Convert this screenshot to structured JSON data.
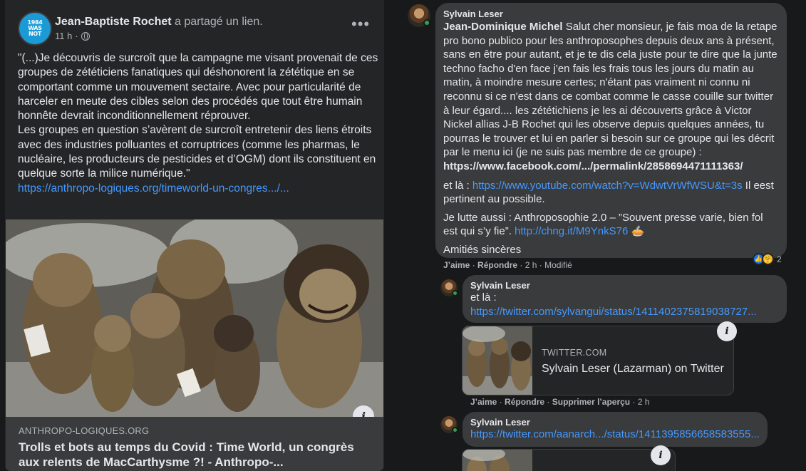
{
  "post": {
    "author": "Jean-Baptiste Rochet",
    "action": "a partagé un lien.",
    "time": "11 h",
    "separator": "·",
    "avatar_text": [
      "1984",
      "WAS",
      "NOT"
    ],
    "more_icon": "more-horizontal-icon",
    "privacy_icon": "globe-icon",
    "text_paragraphs": [
      "\"(...)Je découvris de surcroît que la campagne me visant provenait de ces groupes de zététiciens fanatiques qui déshonorent la zététique en se comportant comme un mouvement sectaire. Avec pour particularité de harceler en meute des cibles selon des procédés que tout être humain honnête devrait inconditionnellement réprouver.",
      "Les groupes en question s’avèrent de surcroît entretenir des liens étroits avec des industries polluantes et corruptrices (comme les pharmas, le nucléaire, les producteurs de pesticides et d’OGM) dont ils constituent en quelque sorte la milice numérique.\""
    ],
    "link": "https://anthropo-logiques.org/timeworld-un-congres.../...",
    "preview": {
      "info_icon": "info-icon",
      "info_glyph": "i",
      "domain": "ANTHROPO-LOGIQUES.ORG",
      "title": "Trolls et bots au temps du Covid : Time World, un congrès aux relents de MacCarthysme ?! - Anthropo-..."
    }
  },
  "comments": {
    "main": {
      "author": "Sylvain Leser",
      "mention": "Jean-Dominique Michel",
      "text_1": " Salut cher monsieur, je fais moa de la retape pro bono publico pour les anthroposophes depuis deux ans à présent, sans en être pour autant, et je te dis cela juste pour te dire que la junte techno facho d'en face j'en fais les frais tous les jours du matin au matin, à moindre mesure certes; n'étant pas vraiment ni connu ni reconnu si ce n'est dans ce combat comme le casse couille sur twitter à leur égard.... les zététichiens je les ai découverts grâce à Victor Nickel allias J-B Rochet qui les observe depuis quelques années, tu pourras le trouver et lui en parler si besoin sur ce groupe qui les décrit par le menu ici (je ne suis pas membre de ce groupe) :",
      "fb_link": "https://www.facebook.com/.../permalink/2858694471111363/",
      "p2_prefix": "et là : ",
      "yt_link": "https://www.youtube.com/watch?v=WdwtVrWfWSU&t=3s",
      "p2_suffix": " Il eest pertinent au possible.",
      "p3_prefix": "Je lutte aussi : Anthroposophie 2.0 – ”Souvent presse varie, bien fol est qui s’y fie”. ",
      "chng_link": "http://chng.it/M9YnkS76",
      "p3_emoji": " 🥧",
      "p4": "Amitiés sincères",
      "actions": {
        "like": "J’aime",
        "reply": "Répondre",
        "time": "2 h",
        "modified": "Modifié",
        "sep": "·"
      },
      "reaction_count": "2",
      "reaction_icons": [
        "like-icon",
        "care-icon"
      ]
    },
    "reply1": {
      "author": "Sylvain Leser",
      "text": "et là :",
      "link": "https://twitter.com/sylvangui/status/1411402375819038727...",
      "card": {
        "info_glyph": "i",
        "domain": "TWITTER.COM",
        "title": "Sylvain Leser (Lazarman) on Twitter"
      },
      "actions": {
        "like": "J’aime",
        "reply": "Répondre",
        "remove_preview": "Supprimer l’aperçu",
        "time": "2 h",
        "sep": "·"
      }
    },
    "reply2": {
      "author": "Sylvain Leser",
      "link": "https://twitter.com/aanarch.../status/1411395856658583555...",
      "info_glyph": "i"
    }
  },
  "colors": {
    "page_bg": "#18191a",
    "card_bg": "#242526",
    "bubble_bg": "#3a3b3c",
    "link": "#4599ff",
    "text_primary": "#e4e6eb",
    "text_secondary": "#b0b3b8",
    "online": "#31a24c"
  }
}
